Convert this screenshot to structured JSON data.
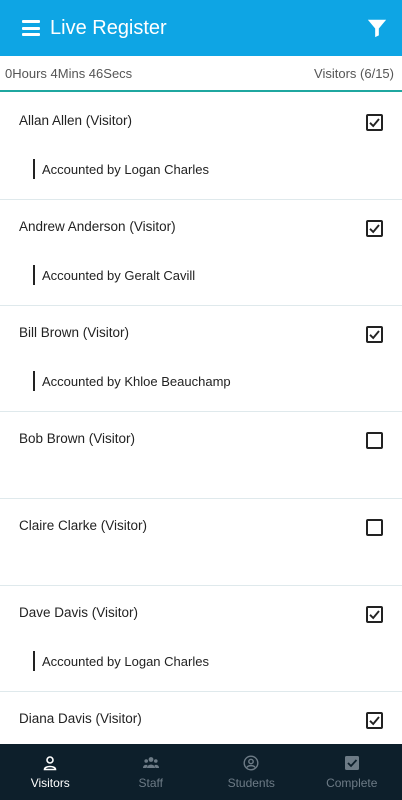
{
  "header": {
    "title": "Live Register",
    "menu_icon": "hamburger-icon",
    "filter_icon": "filter-icon",
    "color": "#0ea5e4"
  },
  "status": {
    "elapsed": "0Hours 4Mins 46Secs",
    "visitors": "Visitors (6/15)"
  },
  "visitors": [
    {
      "name": "Allan Allen (Visitor)",
      "checked": true,
      "accounted": "Accounted by Logan Charles"
    },
    {
      "name": "Andrew Anderson (Visitor)",
      "checked": true,
      "accounted": "Accounted by Geralt Cavill"
    },
    {
      "name": "Bill Brown (Visitor)",
      "checked": true,
      "accounted": "Accounted by Khloe Beauchamp"
    },
    {
      "name": "Bob Brown (Visitor)",
      "checked": false,
      "accounted": ""
    },
    {
      "name": "Claire Clarke (Visitor)",
      "checked": false,
      "accounted": ""
    },
    {
      "name": "Dave Davis (Visitor)",
      "checked": true,
      "accounted": "Accounted by Logan Charles"
    },
    {
      "name": "Diana Davis (Visitor)",
      "checked": true,
      "accounted": ""
    }
  ],
  "nav": {
    "items": [
      {
        "label": "Visitors",
        "icon": "person-icon",
        "active": true
      },
      {
        "label": "Staff",
        "icon": "group-icon",
        "active": false
      },
      {
        "label": "Students",
        "icon": "user-circle-icon",
        "active": false
      },
      {
        "label": "Complete",
        "icon": "checkbox-icon",
        "active": false
      }
    ],
    "background": "#0d1f2b"
  }
}
